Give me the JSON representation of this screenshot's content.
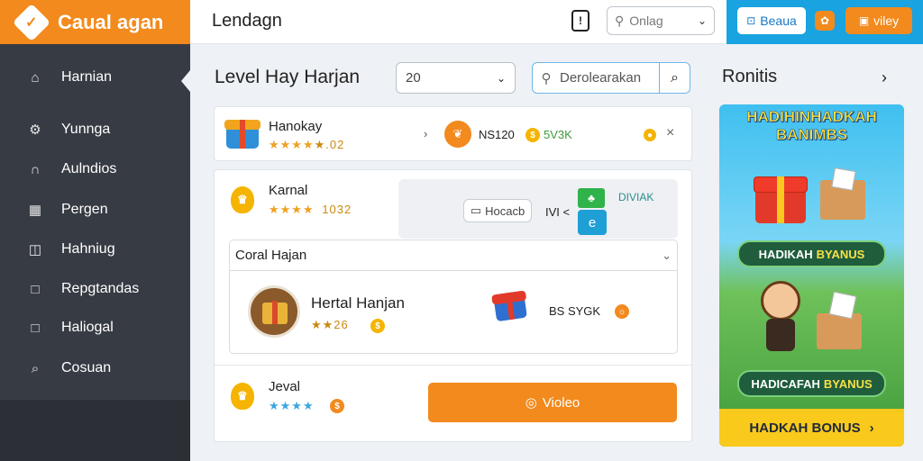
{
  "brand": {
    "title": "Caual agan",
    "logo_icon": "diamond-check-icon"
  },
  "sidebar": {
    "items": [
      {
        "label": "Harnian",
        "icon": "building-icon"
      },
      {
        "label": "Yunnga",
        "icon": "gear-icon"
      },
      {
        "label": "Aulndios",
        "icon": "arch-icon"
      },
      {
        "label": "Pergen",
        "icon": "grid-icon"
      },
      {
        "label": "Hahniug",
        "icon": "image-icon"
      },
      {
        "label": "Repgtandas",
        "icon": "square-icon"
      },
      {
        "label": "Haliogal",
        "icon": "square-icon"
      },
      {
        "label": "Cosuan",
        "icon": "search-icon"
      }
    ]
  },
  "topbar": {
    "title": "Lendagn",
    "icon_label": "!",
    "search_placeholder": "Onlag"
  },
  "topright": {
    "button1_label": "Beaua",
    "button2_label": "viley"
  },
  "filters": {
    "level_title": "Level Hay Harjan",
    "level_value": "20",
    "search_placeholder": "Derolearakan"
  },
  "card1": {
    "name": "Hanokay",
    "rating_text": "★.02",
    "price_text": "NS120",
    "price_badge": "5V3K"
  },
  "card2": {
    "name": "Karnal",
    "rating_text": "1032",
    "inner_button": "Hocacb",
    "code_text": "IVI <",
    "green_label": "DIVIAK",
    "subcard": {
      "header": "Coral Hajan",
      "item_name": "Hertal Hanjan",
      "item_rating": "★★26",
      "item_price": "BS SYGK"
    },
    "bottom": {
      "name": "Jeval",
      "button_label": "Violeo"
    }
  },
  "promo": {
    "section_title": "Ronitis",
    "head": "HADIHINHADKAH BANIMBS",
    "pill1": {
      "a": "HADIKAH",
      "b": "BYANUS"
    },
    "pill2": {
      "a": "HADICAFAH",
      "b": "BYANUS"
    },
    "footer": "HADKAH BONUS"
  },
  "colors": {
    "brand": "#f28a1d",
    "accent": "#19a3e0",
    "sidebar": "#373b43"
  }
}
